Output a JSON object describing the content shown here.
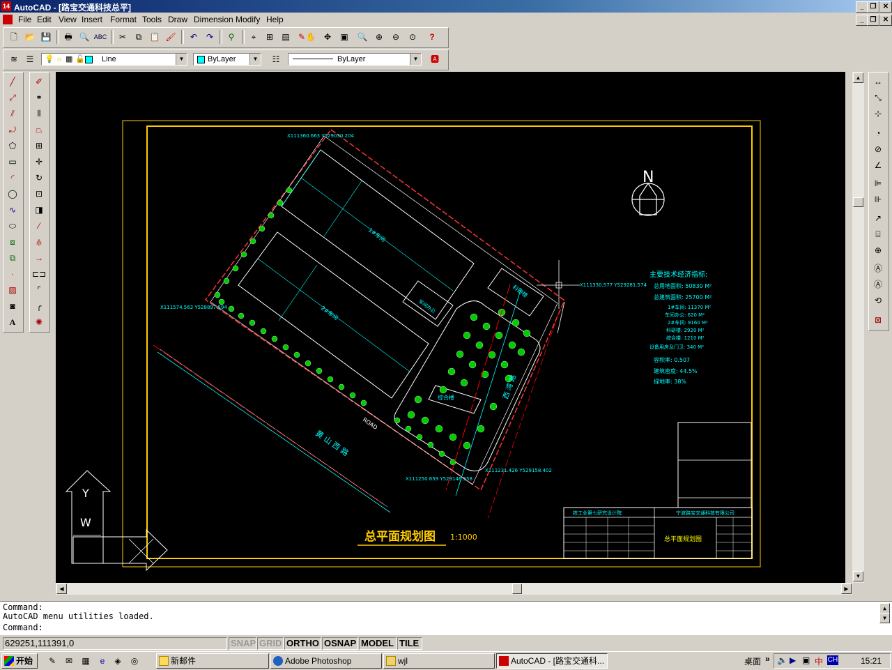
{
  "window": {
    "title": "AutoCAD - [路宝交通科技总平]",
    "app_icon": "14"
  },
  "menu": [
    {
      "label": "File"
    },
    {
      "label": "Edit"
    },
    {
      "label": "View"
    },
    {
      "label": "Insert"
    },
    {
      "label": "Format"
    },
    {
      "label": "Tools"
    },
    {
      "label": "Draw"
    },
    {
      "label": "Dimension"
    },
    {
      "label": "Modify"
    },
    {
      "label": "Help"
    }
  ],
  "properties": {
    "layer": "Line",
    "color": "ByLayer",
    "linetype": "ByLayer"
  },
  "drawing": {
    "title": "总平面规划图",
    "scale": "1:1000",
    "north": "N",
    "ucs_y": "Y",
    "ucs_w": "W",
    "road_name": "黄 山 西 路",
    "road_name2": "西 湾 路",
    "indicators_title": "主要技术经济指标:",
    "indicators": [
      "总用地面积: 50830 M²",
      "总建筑面积: 25700 M²",
      "1#车间: 11370 M²",
      "车间办公: 620 M²",
      "2#车间: 9160 M²",
      "科研楼: 2920 M²",
      "综合楼: 1210 M²",
      "设备用房及门卫: 340 M²",
      "容积率: 0.507",
      "建筑密度: 44.5%",
      "绿地率: 38%"
    ],
    "coords": [
      "X111360.663 Y529030.204",
      "X111574.563 Y528897.594",
      "X111330.577 Y529281.574",
      "X111250.659 Y529146.558",
      "X111231.426 Y529158.402"
    ],
    "titleblock_company": "铁工业第七研究设计院",
    "titleblock_client": "宁波路宝交通科技有限公司",
    "titleblock_drawing": "总平面规划图",
    "building_labels": [
      "1#车间",
      "2#车间",
      "科研楼",
      "综合楼",
      "车间办公"
    ],
    "road_label": "ROAD"
  },
  "command": {
    "line1": "Command:",
    "line2": "AutoCAD menu utilities loaded.",
    "prompt": "Command:"
  },
  "status": {
    "coords": "629251,111391,0",
    "toggles": [
      {
        "label": "SNAP",
        "on": false
      },
      {
        "label": "GRID",
        "on": false
      },
      {
        "label": "ORTHO",
        "on": true
      },
      {
        "label": "OSNAP",
        "on": true
      },
      {
        "label": "MODEL",
        "on": true
      },
      {
        "label": "TILE",
        "on": true
      }
    ]
  },
  "taskbar": {
    "start": "开始",
    "tasks": [
      {
        "label": "新邮件",
        "active": false
      },
      {
        "label": "Adobe Photoshop",
        "active": false
      },
      {
        "label": "wjl",
        "active": false
      },
      {
        "label": "AutoCAD - [路宝交通科...",
        "active": true
      }
    ],
    "desktop": "桌面",
    "lang": "CH",
    "clock": "15:21"
  },
  "colors": {
    "drawing_bg": "#000000",
    "frame": "#ffcc00",
    "cyan": "#00ffff",
    "green": "#00ff00",
    "red": "#ff0000",
    "yellow": "#ffff00",
    "white": "#ffffff"
  }
}
